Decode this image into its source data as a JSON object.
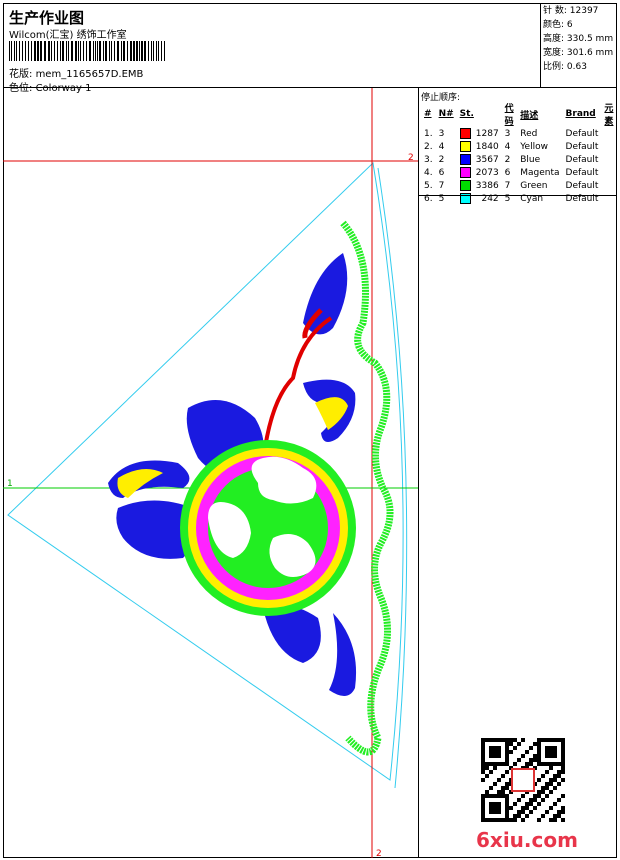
{
  "header": {
    "title": "生产作业图",
    "subtitle": "Wilcom(汇宝) 绣饰工作室",
    "design_label": "花版:",
    "design_file": "mem_1165657D.EMB",
    "colorway_label": "色位:",
    "colorway": "Colorway 1"
  },
  "stats": {
    "stitches_label": "针 数:",
    "stitches": "12397",
    "colors_label": "颜色:",
    "colors": "6",
    "height_label": "高度:",
    "height": "330.5 mm",
    "width_label": "宽度:",
    "width": "301.6 mm",
    "ratio_label": "比例:",
    "ratio": "0.63"
  },
  "stop_sequence": {
    "title": "停止顺序:",
    "headers": [
      "#",
      "N#",
      "St.",
      "代码",
      "描述",
      "Brand",
      "元素"
    ],
    "rows": [
      {
        "idx": "1.",
        "n": "3",
        "st": "1287",
        "code": "3",
        "desc": "Red",
        "brand": "Default",
        "color": "#ff0000"
      },
      {
        "idx": "2.",
        "n": "4",
        "st": "1840",
        "code": "4",
        "desc": "Yellow",
        "brand": "Default",
        "color": "#ffff00"
      },
      {
        "idx": "3.",
        "n": "2",
        "st": "3567",
        "code": "2",
        "desc": "Blue",
        "brand": "Default",
        "color": "#0000ff"
      },
      {
        "idx": "4.",
        "n": "6",
        "st": "2073",
        "code": "6",
        "desc": "Magenta",
        "brand": "Default",
        "color": "#ff00ff"
      },
      {
        "idx": "5.",
        "n": "7",
        "st": "3386",
        "code": "7",
        "desc": "Green",
        "brand": "Default",
        "color": "#00dd00"
      },
      {
        "idx": "6.",
        "n": "5",
        "st": "242",
        "code": "5",
        "desc": "Cyan",
        "brand": "Default",
        "color": "#00ffff"
      }
    ]
  },
  "canvas": {
    "marker_h1": "2",
    "marker_h2": "2",
    "marker_v": "1"
  },
  "watermark": "6xiu.com"
}
